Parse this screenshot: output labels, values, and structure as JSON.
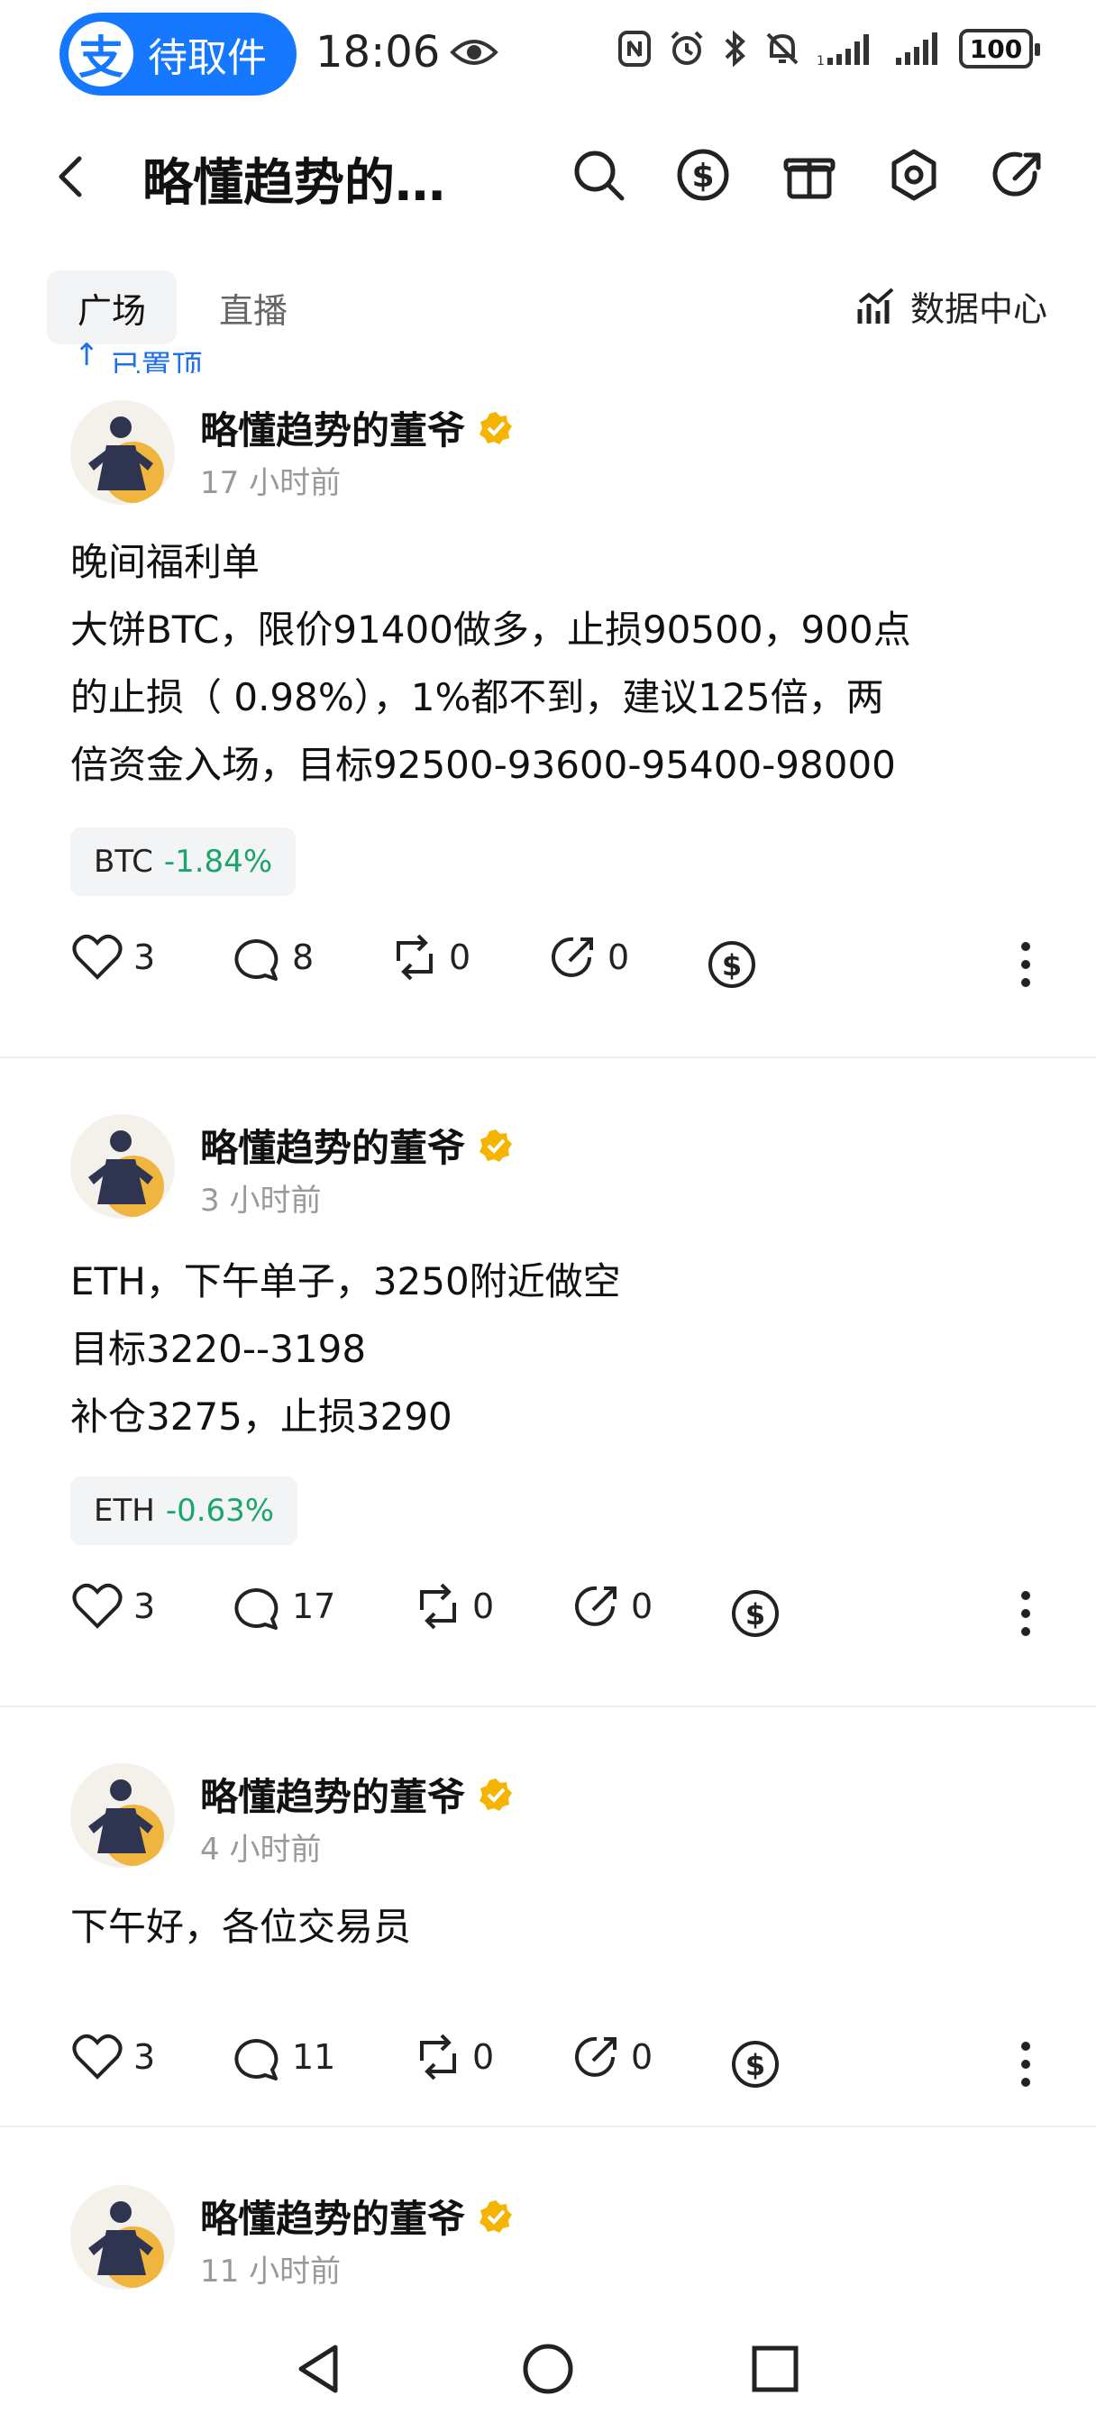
{
  "status_bar": {
    "pill_label": "待取件",
    "alipay_glyph": "支",
    "time": "18:06",
    "battery": "100"
  },
  "header": {
    "title": "略懂趋势的…"
  },
  "tabs": [
    {
      "label": "广场",
      "active": true
    },
    {
      "label": "直播",
      "active": false
    }
  ],
  "data_center_label": "数据中心",
  "pinned_label": "已置顶",
  "posts": [
    {
      "author": "略懂趋势的董爷",
      "time": "17 小时前",
      "lines": [
        "晚间福利单",
        "大饼BTC，限价91400做多，止损90500，900点",
        "的止损（ 0.98%），1%都不到，建议125倍，两",
        "倍资金入场，目标92500-93600-95400-98000"
      ],
      "ticker": {
        "symbol": "BTC",
        "change": "-1.84%"
      },
      "likes": "3",
      "comments": "8",
      "reposts": "0",
      "shares": "0"
    },
    {
      "author": "略懂趋势的董爷",
      "time": "3 小时前",
      "lines": [
        "ETH，下午单子，3250附近做空",
        "目标3220--3198",
        "补仓3275，止损3290"
      ],
      "ticker": {
        "symbol": "ETH",
        "change": "-0.63%"
      },
      "likes": "3",
      "comments": "17",
      "reposts": "0",
      "shares": "0"
    },
    {
      "author": "略懂趋势的董爷",
      "time": "4 小时前",
      "lines": [
        "下午好，各位交易员"
      ],
      "likes": "3",
      "comments": "11",
      "reposts": "0",
      "shares": "0"
    },
    {
      "author": "略懂趋势的董爷",
      "time": "11 小时前"
    }
  ],
  "colors": {
    "accent_blue": "#1677ff",
    "negative_change": "#1aa56a",
    "verified_badge": "#f5b400"
  }
}
